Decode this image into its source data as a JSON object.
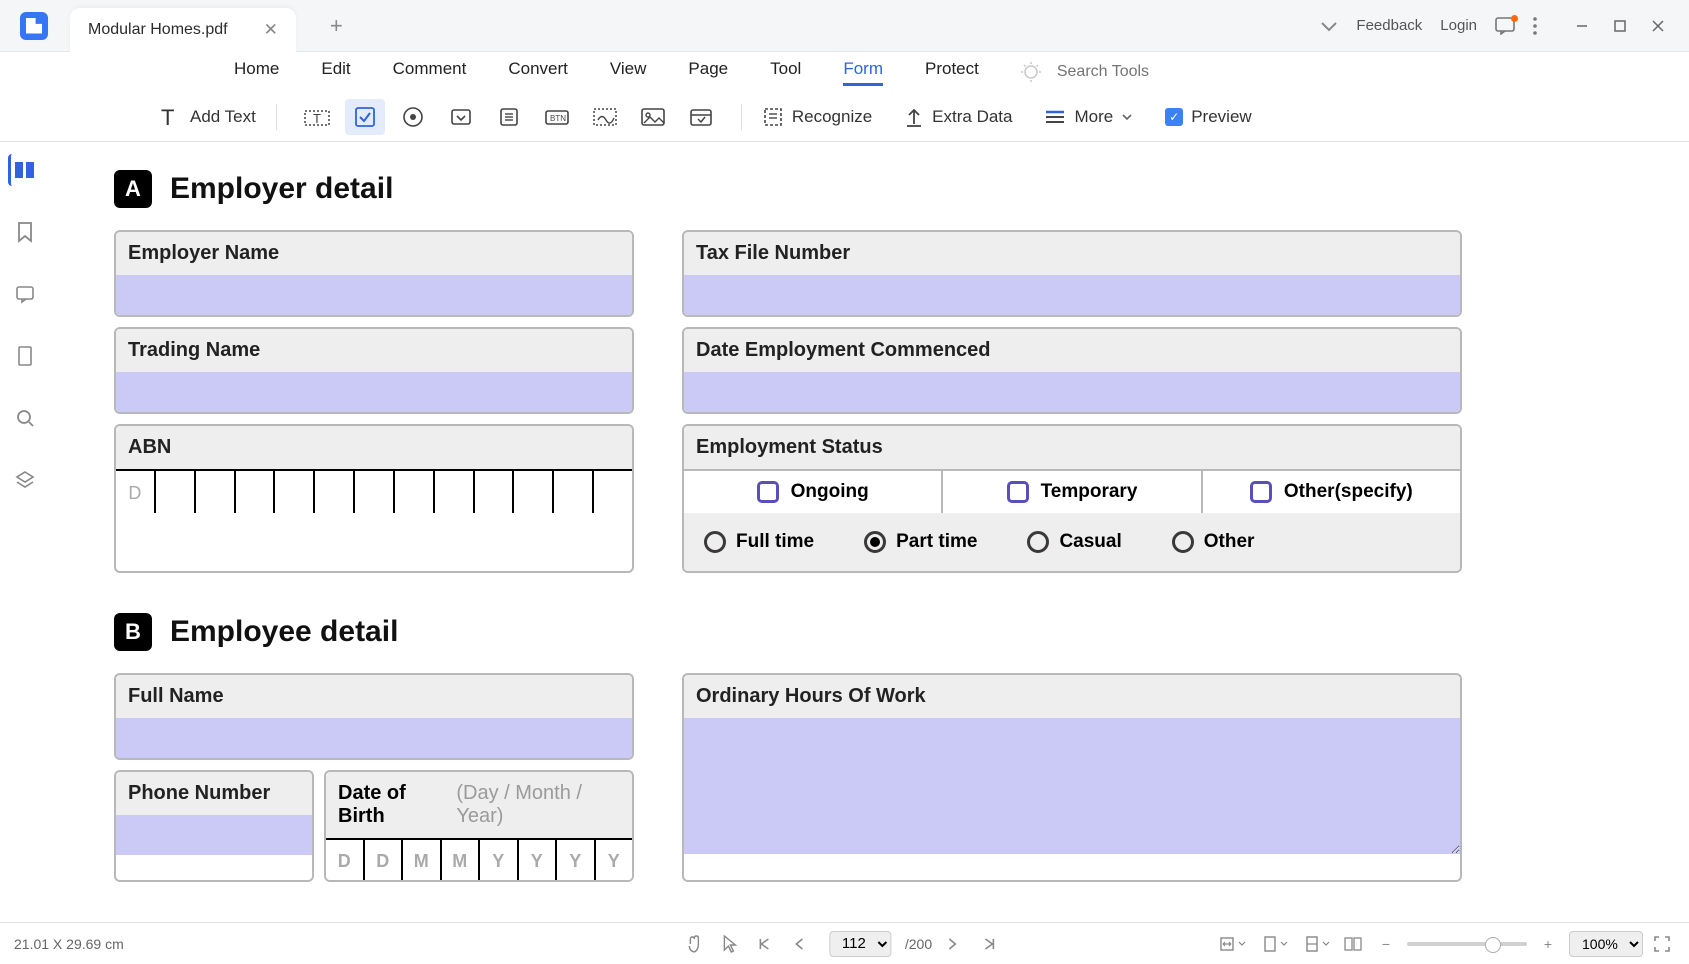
{
  "titlebar": {
    "tab_name": "Modular Homes.pdf",
    "feedback": "Feedback",
    "login": "Login"
  },
  "menu": {
    "items": [
      "Home",
      "Edit",
      "Comment",
      "Convert",
      "View",
      "Page",
      "Tool",
      "Form",
      "Protect"
    ],
    "active": "Form",
    "search_placeholder": "Search Tools"
  },
  "toolbar": {
    "add_text": "Add Text",
    "recognize": "Recognize",
    "extra_data": "Extra Data",
    "more": "More",
    "preview": "Preview"
  },
  "form": {
    "section_a": {
      "badge": "A",
      "title": "Employer detail"
    },
    "section_b": {
      "badge": "B",
      "title": "Employee detail"
    },
    "employer_name": "Employer Name",
    "trading_name": "Trading Name",
    "abn": "ABN",
    "abn_placeholder": "D",
    "tax_file": "Tax File Number",
    "date_commenced": "Date Employment Commenced",
    "emp_status": "Employment Status",
    "status_opts": [
      "Ongoing",
      "Temporary",
      "Other(specify)"
    ],
    "time_opts": [
      "Full time",
      "Part time",
      "Casual",
      "Other"
    ],
    "time_selected": "Part time",
    "full_name": "Full Name",
    "phone": "Phone Number",
    "dob": "Date of Birth",
    "dob_hint": "(Day / Month / Year)",
    "dob_cells": [
      "D",
      "D",
      "M",
      "M",
      "Y",
      "Y",
      "Y",
      "Y"
    ],
    "ordinary_hours": "Ordinary Hours Of Work"
  },
  "statusbar": {
    "dimensions": "21.01 X 29.69 cm",
    "page_current": "112",
    "page_total": "/200",
    "zoom": "100%"
  }
}
